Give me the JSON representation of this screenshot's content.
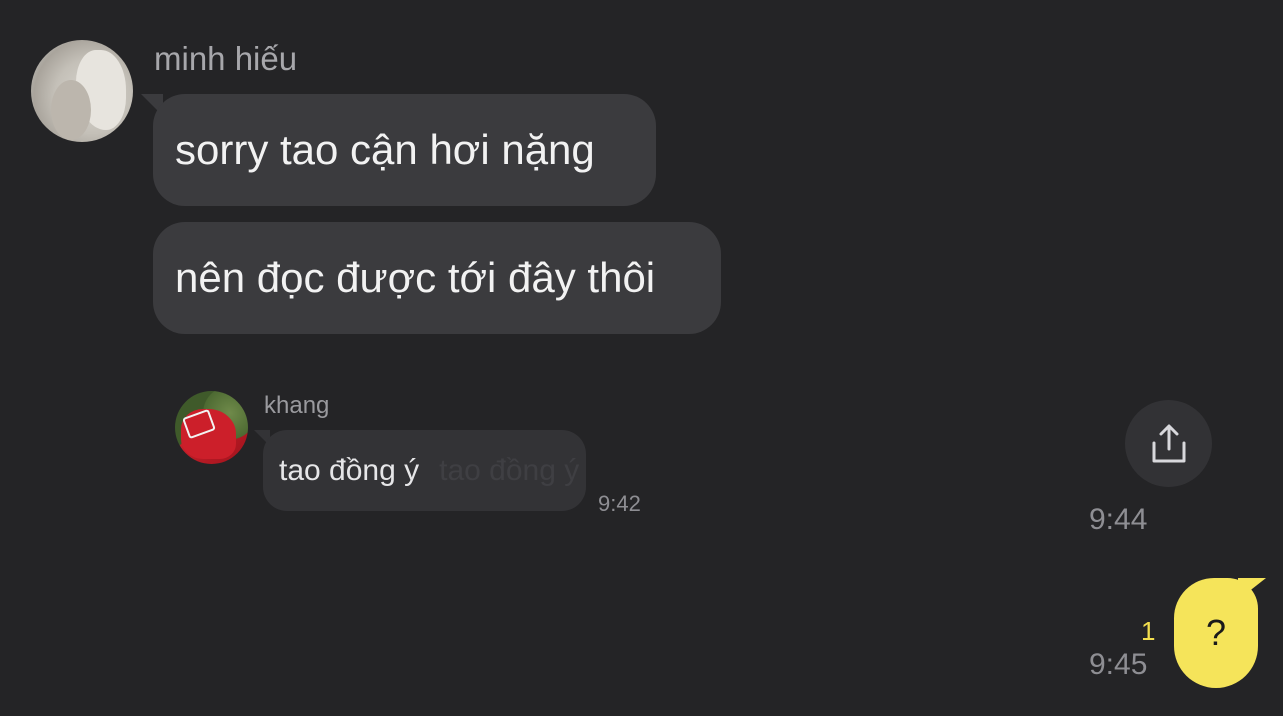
{
  "messages": {
    "minh": {
      "sender_name": "minh hiếu",
      "bubble_1": "sorry tao cận hơi nặng",
      "bubble_2": "nên đọc được tới đây thôi"
    },
    "reply": {
      "sender_name": "khang",
      "text": "tao đồng ý",
      "ghost_text": "tao đồng ý",
      "time": "9:42"
    },
    "forward_time": "9:44",
    "mine": {
      "text": "?",
      "unread_count": "1",
      "time": "9:45"
    }
  },
  "icons": {
    "share": "share-icon"
  },
  "colors": {
    "background": "#242426",
    "incoming_bubble": "#3b3b3e",
    "outgoing_bubble": "#f5e45a",
    "unread": "#f2de4e"
  }
}
